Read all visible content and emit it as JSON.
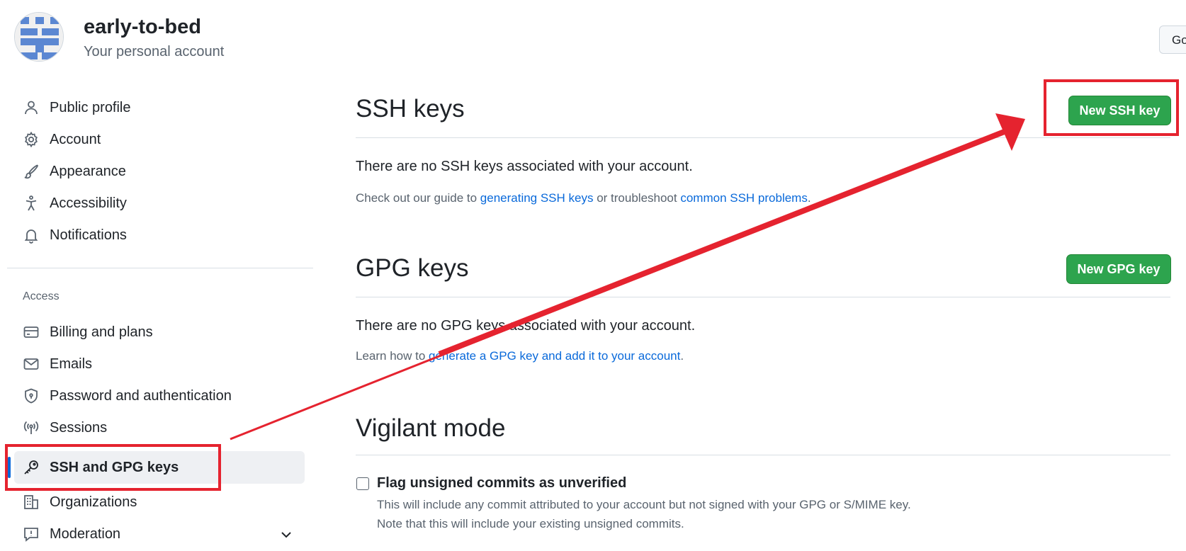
{
  "account": {
    "username": "early-to-bed",
    "subtitle": "Your personal account",
    "go_label": "Go"
  },
  "sidebar": {
    "items": [
      {
        "label": "Public profile",
        "icon": "person-icon"
      },
      {
        "label": "Account",
        "icon": "gear-icon"
      },
      {
        "label": "Appearance",
        "icon": "paintbrush-icon"
      },
      {
        "label": "Accessibility",
        "icon": "accessibility-icon"
      },
      {
        "label": "Notifications",
        "icon": "bell-icon"
      }
    ],
    "access_heading": "Access",
    "access_items": [
      {
        "label": "Billing and plans",
        "icon": "credit-card-icon"
      },
      {
        "label": "Emails",
        "icon": "mail-icon"
      },
      {
        "label": "Password and authentication",
        "icon": "shield-lock-icon"
      },
      {
        "label": "Sessions",
        "icon": "broadcast-icon"
      },
      {
        "label": "SSH and GPG keys",
        "icon": "key-icon",
        "active": true
      },
      {
        "label": "Organizations",
        "icon": "organization-icon"
      },
      {
        "label": "Moderation",
        "icon": "report-icon",
        "expandable": true
      }
    ]
  },
  "ssh": {
    "title": "SSH keys",
    "button": "New SSH key",
    "empty": "There are no SSH keys associated with your account.",
    "guide_prefix": "Check out our guide to ",
    "guide_link1": "generating SSH keys",
    "guide_middle": " or troubleshoot ",
    "guide_link2": "common SSH problems",
    "guide_suffix": "."
  },
  "gpg": {
    "title": "GPG keys",
    "button": "New GPG key",
    "empty": "There are no GPG keys associated with your account.",
    "learn_prefix": "Learn how to ",
    "learn_link": "generate a GPG key and add it to your account",
    "learn_suffix": "."
  },
  "vigilant": {
    "title": "Vigilant mode",
    "checkbox_label": "Flag unsigned commits as unverified",
    "checked": false,
    "note1": "This will include any commit attributed to your account but not signed with your GPG or S/MIME key.",
    "note2": "Note that this will include your existing unsigned commits."
  },
  "colors": {
    "accent": "#0969da",
    "button_green": "#2da44e",
    "annotation_red": "#e5232f"
  }
}
